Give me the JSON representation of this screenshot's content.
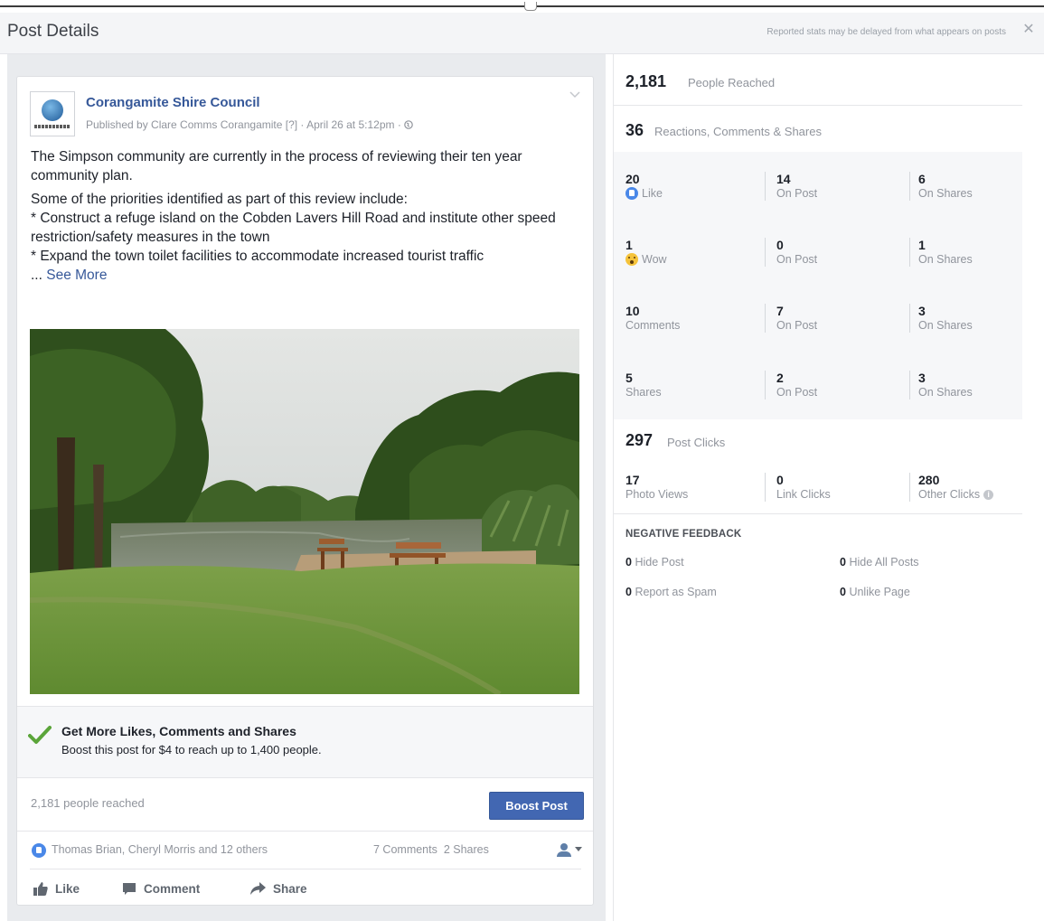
{
  "header": {
    "title": "Post Details",
    "note": "Reported stats may be delayed from what appears on posts",
    "close_glyph": "✕"
  },
  "post": {
    "page_name": "Corangamite Shire Council",
    "meta": "Published by Clare Comms Corangamite [?] · April 26 at 5:12pm · ",
    "text_intro": "The Simpson community are currently in the process of reviewing their ten year community plan.",
    "text_lines": [
      "Some of the priorities identified as part of this review include:",
      "* Construct a refuge island on the Cobden Lavers Hill Road and institute other speed restriction/safety measures in the town",
      "* Expand the town toilet facilities to accommodate increased tourist traffic"
    ],
    "ellipsis": "... ",
    "see_more": "See More",
    "boost": {
      "title": "Get More Likes, Comments and Shares",
      "subtitle": "Boost this post for $4 to reach up to 1,400 people."
    },
    "people_reached": "2,181 people reached",
    "boost_button": "Boost Post",
    "reactors": "Thomas Brian, Cheryl Morris and 12 others",
    "comments_count": "7 Comments",
    "shares_count": "2 Shares",
    "actions": {
      "like": "Like",
      "comment": "Comment",
      "share": "Share"
    }
  },
  "stats": {
    "reached": {
      "value": "2,181",
      "label": "People Reached"
    },
    "engagement": {
      "value": "36",
      "label": "Reactions, Comments & Shares"
    },
    "rows": [
      {
        "total": "20",
        "label": "Like",
        "icon": "like-icon",
        "on_post": "14",
        "on_shares": "6"
      },
      {
        "total": "1",
        "label": "Wow",
        "icon": "wow-icon",
        "on_post": "0",
        "on_shares": "1"
      },
      {
        "total": "10",
        "label": "Comments",
        "icon": "",
        "on_post": "7",
        "on_shares": "3"
      },
      {
        "total": "5",
        "label": "Shares",
        "icon": "",
        "on_post": "2",
        "on_shares": "3"
      }
    ],
    "on_post_label": "On Post",
    "on_shares_label": "On Shares",
    "clicks": {
      "value": "297",
      "label": "Post Clicks",
      "photo_views": "17",
      "photo_views_label": "Photo Views",
      "link_clicks": "0",
      "link_clicks_label": "Link Clicks",
      "other_clicks": "280",
      "other_clicks_label": "Other Clicks"
    },
    "negative": {
      "title": "NEGATIVE FEEDBACK",
      "hide_post": "0",
      "hide_post_label": "Hide Post",
      "hide_all": "0",
      "hide_all_label": "Hide All Posts",
      "spam": "0",
      "spam_label": "Report as Spam",
      "unlike": "0",
      "unlike_label": "Unlike Page"
    }
  },
  "colors": {
    "link": "#365899",
    "boost_button": "#4267b2",
    "check": "#5ba53a",
    "muted": "#90949c"
  }
}
